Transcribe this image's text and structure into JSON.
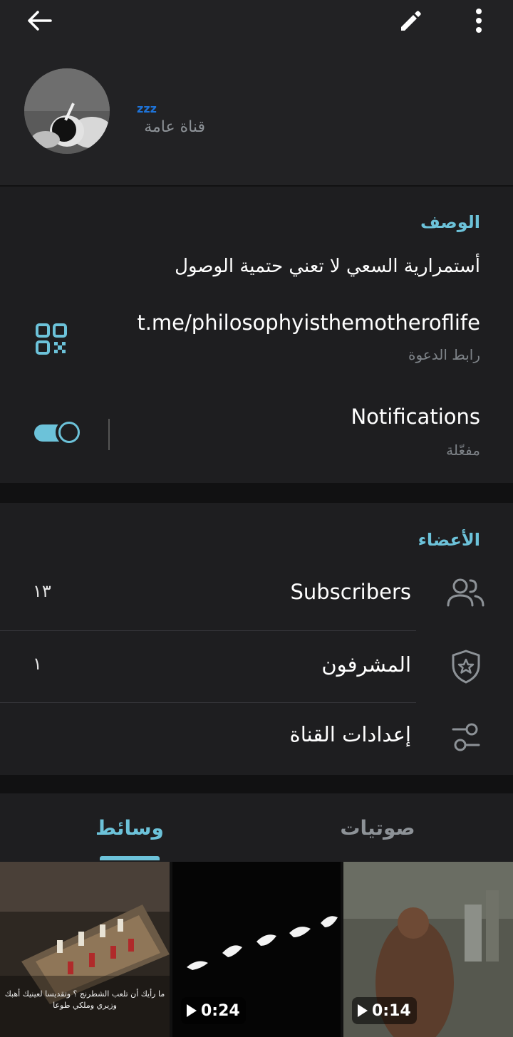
{
  "header": {
    "channel_name": "zzz",
    "channel_type": "قناة عامة",
    "icons": {
      "back": "arrow-left-icon",
      "edit": "pencil-icon",
      "more": "more-vertical-icon"
    }
  },
  "info": {
    "description_title": "الوصف",
    "description_text": "أستمرارية السعي لا تعني حتمية الوصول",
    "invite_link": "t.me/philosophyisthemotheroflife",
    "invite_link_caption": "رابط الدعوة",
    "notifications_label": "Notifications",
    "notifications_status": "مفعّلة",
    "notifications_enabled": true
  },
  "members": {
    "title": "الأعضاء",
    "rows": [
      {
        "label": "Subscribers",
        "value": "١٣",
        "icon": "people-icon"
      },
      {
        "label": "المشرفون",
        "value": "١",
        "icon": "shield-star-icon"
      },
      {
        "label": "إعدادات القناة",
        "value": "",
        "icon": "sliders-icon"
      }
    ]
  },
  "media": {
    "tabs": [
      {
        "label": "وسائط",
        "active": true
      },
      {
        "label": "صوتيات",
        "active": false
      }
    ],
    "thumbnails": [
      {
        "kind": "image",
        "caption": "ما رأيك أن تلعب الشطرنج ؟ وتقديسا لعينيك أهبك وزيري وملكي طوعا"
      },
      {
        "kind": "video",
        "duration": "0:24"
      },
      {
        "kind": "video",
        "duration": "0:14"
      }
    ]
  },
  "colors": {
    "accent": "#6cc2d9",
    "header_bg": "#222224",
    "card_bg": "#1e1e20",
    "page_bg": "#111112"
  }
}
